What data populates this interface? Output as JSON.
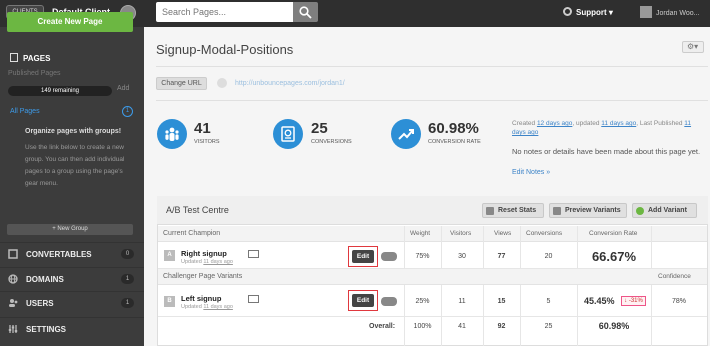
{
  "topbar": {
    "clients_label": "CLIENTS",
    "client_name": "Default Client",
    "search_placeholder": "Search Pages...",
    "support_label": "Support",
    "user_name": "Jordan Woo..."
  },
  "sidebar": {
    "create_label": "Create New Page",
    "pages_heading": "PAGES",
    "published_label": "Published Pages",
    "remaining_label": "149 remaining",
    "add_label": "Add",
    "all_pages_label": "All Pages",
    "all_pages_count": "1",
    "organize_heading": "Organize pages with groups!",
    "organize_text": "Use the link below to create a new group. You can then add individual pages to a group using the page's gear menu.",
    "new_group_label": "+ New Group",
    "nav": [
      {
        "label": "CONVERTABLES",
        "count": "0",
        "icon": "convertables-icon"
      },
      {
        "label": "DOMAINS",
        "count": "1",
        "icon": "globe-icon"
      },
      {
        "label": "USERS",
        "count": "1",
        "icon": "users-icon"
      },
      {
        "label": "SETTINGS",
        "count": "",
        "icon": "settings-icon"
      }
    ]
  },
  "page": {
    "title": "Signup-Modal-Positions",
    "change_url_label": "Change URL",
    "url": "http://unbouncepages.com/jordan1/",
    "stats": [
      {
        "value": "41",
        "label": "VISITORS",
        "icon": "visitors-icon"
      },
      {
        "value": "25",
        "label": "CONVERSIONS",
        "icon": "conversions-icon"
      },
      {
        "value": "60.98%",
        "label": "CONVERSION RATE",
        "icon": "trend-icon"
      }
    ],
    "meta": {
      "created_prefix": "Created",
      "created_link": "12 days ago",
      "updated_prefix": ", updated",
      "updated_link": "11 days ago",
      "published_prefix": ", Last Published",
      "published_link": "11 days ago"
    },
    "no_notes": "No notes or details have been made about this page yet.",
    "edit_notes_label": "Edit Notes »"
  },
  "ab": {
    "title": "A/B Test Centre",
    "reset_label": "Reset Stats",
    "preview_label": "Preview Variants",
    "add_variant_label": "Add Variant",
    "current_champion_label": "Current Champion",
    "challenger_label": "Challenger Page Variants",
    "columns": {
      "weight": "Weight",
      "visitors": "Visitors",
      "views": "Views",
      "conversions": "Conversions",
      "rate": "Conversion Rate",
      "confidence": "Confidence"
    },
    "variants": [
      {
        "letter": "A",
        "name": "Right signup",
        "updated_prefix": "Updated",
        "updated_link": "11 days ago",
        "edit": "Edit",
        "weight": "75%",
        "visitors": "30",
        "views": "77",
        "conversions": "20",
        "rate": "66.67%",
        "change": "",
        "confidence": ""
      },
      {
        "letter": "B",
        "name": "Left signup",
        "updated_prefix": "Updated",
        "updated_link": "11 days ago",
        "edit": "Edit",
        "weight": "25%",
        "visitors": "11",
        "views": "15",
        "conversions": "5",
        "rate": "45.45%",
        "change": "↓ -31%",
        "confidence": "78%"
      }
    ],
    "overall": {
      "label": "Overall:",
      "weight": "100%",
      "visitors": "41",
      "views": "92",
      "conversions": "25",
      "rate": "60.98%"
    }
  },
  "colors": {
    "accent": "#2c8fd6",
    "create": "#6cb742",
    "sidebar": "#3c3c3c",
    "topbar": "#2f2f2f",
    "highlight": "#e0383e"
  }
}
